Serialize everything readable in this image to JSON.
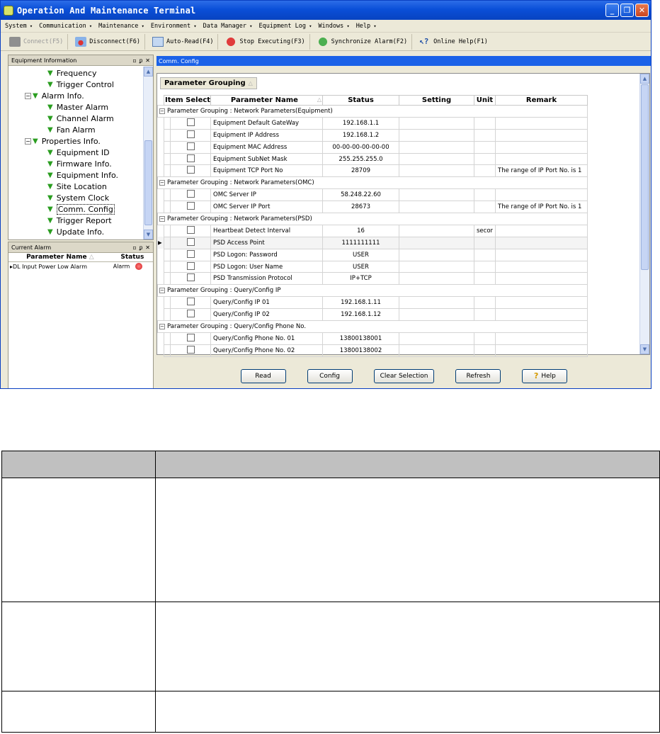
{
  "window": {
    "title": "Operation And Maintenance Terminal"
  },
  "menu": [
    "System",
    "Communication",
    "Maintenance",
    "Environment",
    "Data Manager",
    "Equipment Log",
    "Windows",
    "Help"
  ],
  "toolbar": {
    "connect": "Connect(F5)",
    "disconnect": "Disconnect(F6)",
    "auto_read": "Auto-Read(F4)",
    "stop": "Stop Executing(F3)",
    "sync": "Synchronize Alarm(F2)",
    "help": "Online Help(F1)"
  },
  "equipment_panel": {
    "title": "Equipment Information",
    "items": [
      {
        "label": "Frequency"
      },
      {
        "label": "Trigger Control"
      },
      {
        "label": "Alarm Info."
      },
      {
        "label": "Master Alarm"
      },
      {
        "label": "Channel Alarm"
      },
      {
        "label": "Fan Alarm"
      },
      {
        "label": "Properties Info."
      },
      {
        "label": "Equipment ID"
      },
      {
        "label": "Firmware Info."
      },
      {
        "label": "Equipment Info."
      },
      {
        "label": "Site Location"
      },
      {
        "label": "System Clock"
      },
      {
        "label": "Comm. Config"
      },
      {
        "label": "Trigger Report"
      },
      {
        "label": "Update Info."
      }
    ]
  },
  "alarm_panel": {
    "title": "Current Alarm",
    "col_name": "Parameter Name",
    "col_status": "Status",
    "rows": [
      {
        "name": "DL Input Power Low Alarm",
        "status": "Alarm"
      }
    ]
  },
  "main": {
    "tab": "Comm. Config",
    "group_chip": "Parameter Grouping",
    "columns": [
      "Item Select",
      "Parameter Name",
      "Status",
      "Setting",
      "Unit",
      "Remark"
    ],
    "groups": [
      {
        "label": "Parameter Grouping : Network Parameters(Equipment)",
        "rows": [
          {
            "name": "Equipment Default GateWay",
            "status": "192.168.1.1",
            "unit": "",
            "remark": ""
          },
          {
            "name": "Equipment IP Address",
            "status": "192.168.1.2",
            "unit": "",
            "remark": ""
          },
          {
            "name": "Equipment MAC Address",
            "status": "00-00-00-00-00-00",
            "unit": "",
            "remark": ""
          },
          {
            "name": "Equipment SubNet Mask",
            "status": "255.255.255.0",
            "unit": "",
            "remark": ""
          },
          {
            "name": "Equipment TCP Port No",
            "status": "28709",
            "unit": "",
            "remark": "The range of IP Port No. is 1"
          }
        ]
      },
      {
        "label": "Parameter Grouping : Network Parameters(OMC)",
        "rows": [
          {
            "name": "OMC Server IP",
            "status": "58.248.22.60",
            "unit": "",
            "remark": ""
          },
          {
            "name": "OMC Server IP Port",
            "status": "28673",
            "unit": "",
            "remark": "The range of IP Port No. is 1"
          }
        ]
      },
      {
        "label": "Parameter Grouping : Network Parameters(PSD)",
        "rows": [
          {
            "name": "Heartbeat Detect Interval",
            "status": "16",
            "unit": "secor",
            "remark": ""
          },
          {
            "name": "PSD Access Point",
            "status": "1111111111",
            "unit": "",
            "remark": ""
          },
          {
            "name": "PSD Logon: Password",
            "status": "USER",
            "unit": "",
            "remark": ""
          },
          {
            "name": "PSD Logon: User Name",
            "status": "USER",
            "unit": "",
            "remark": ""
          },
          {
            "name": "PSD Transmission Protocol",
            "status": "IP+TCP",
            "unit": "",
            "remark": ""
          }
        ]
      },
      {
        "label": "Parameter Grouping : Query/Config IP",
        "rows": [
          {
            "name": "Query/Config IP 01",
            "status": "192.168.1.11",
            "unit": "",
            "remark": ""
          },
          {
            "name": "Query/Config IP 02",
            "status": "192.168.1.12",
            "unit": "",
            "remark": ""
          }
        ]
      },
      {
        "label": "Parameter Grouping : Query/Config Phone No.",
        "rows": [
          {
            "name": "Query/Config Phone No. 01",
            "status": "13800138001",
            "unit": "",
            "remark": ""
          },
          {
            "name": "Query/Config Phone No. 02",
            "status": "13800138002",
            "unit": "",
            "remark": ""
          }
        ]
      }
    ],
    "buttons": {
      "read": "Read",
      "config": "Config",
      "clear": "Clear Selection",
      "refresh": "Refresh",
      "help": "Help"
    }
  }
}
